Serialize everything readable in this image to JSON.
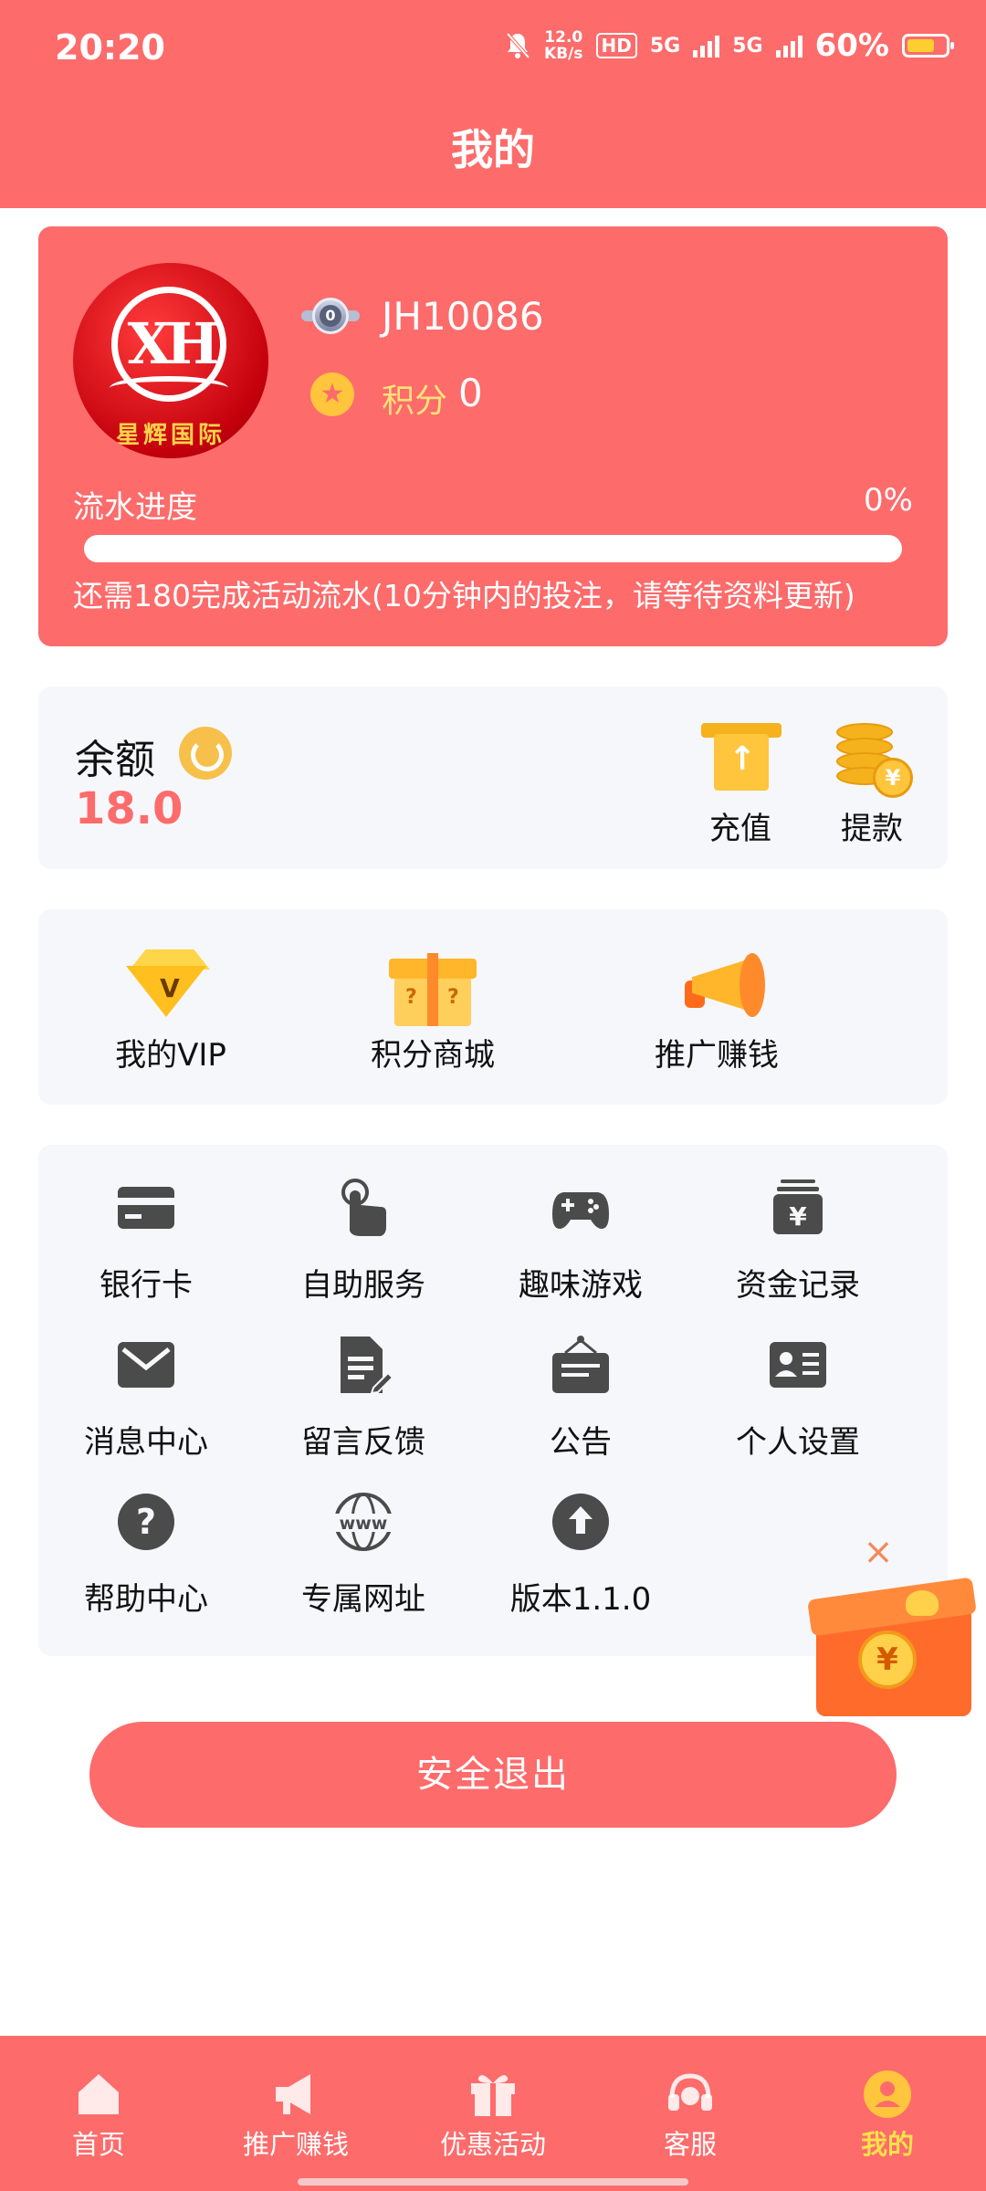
{
  "status": {
    "time": "20:20",
    "net_speed_top": "12.0",
    "net_speed_unit": "KB/s",
    "hd": "HD",
    "sig1": "5G",
    "sig2": "5G",
    "battery": "60%"
  },
  "header": {
    "title": "我的"
  },
  "profile": {
    "avatar_text": "XH",
    "avatar_caption": "星辉国际",
    "level_badge": "0",
    "username": "JH10086",
    "points_label": "积分",
    "points_value": "0",
    "flow_label": "流水进度",
    "flow_percent": "0%",
    "flow_progress": 0,
    "flow_note": "还需180完成活动流水(10分钟内的投注，请等待资料更新)"
  },
  "balance": {
    "label": "余额",
    "value": "18.0",
    "recharge_label": "充值",
    "withdraw_label": "提款"
  },
  "features": [
    {
      "label": "我的VIP",
      "icon": "vip-diamond-icon"
    },
    {
      "label": "积分商城",
      "icon": "gift-box-icon"
    },
    {
      "label": "推广赚钱",
      "icon": "megaphone-icon"
    }
  ],
  "services": [
    {
      "label": "银行卡",
      "icon": "bank-card-icon"
    },
    {
      "label": "自助服务",
      "icon": "tap-hand-icon"
    },
    {
      "label": "趣味游戏",
      "icon": "gamepad-icon"
    },
    {
      "label": "资金记录",
      "icon": "fund-record-icon"
    },
    {
      "label": "消息中心",
      "icon": "mail-icon"
    },
    {
      "label": "留言反馈",
      "icon": "feedback-icon"
    },
    {
      "label": "公告",
      "icon": "notice-board-icon"
    },
    {
      "label": "个人设置",
      "icon": "id-card-icon"
    },
    {
      "label": "帮助中心",
      "icon": "help-icon"
    },
    {
      "label": "专属网址",
      "icon": "www-icon"
    },
    {
      "label": "版本1.1.0",
      "icon": "upload-arrow-icon"
    }
  ],
  "logout_label": "安全退出",
  "nav": [
    {
      "label": "首页",
      "icon": "home-icon"
    },
    {
      "label": "推广赚钱",
      "icon": "megaphone-icon"
    },
    {
      "label": "优惠活动",
      "icon": "gift-icon"
    },
    {
      "label": "客服",
      "icon": "headset-icon"
    },
    {
      "label": "我的",
      "icon": "user-icon",
      "active": true
    }
  ],
  "colors": {
    "primary": "#fd6b6b",
    "accent": "#ffc53d",
    "active_nav": "#ffe04a"
  }
}
